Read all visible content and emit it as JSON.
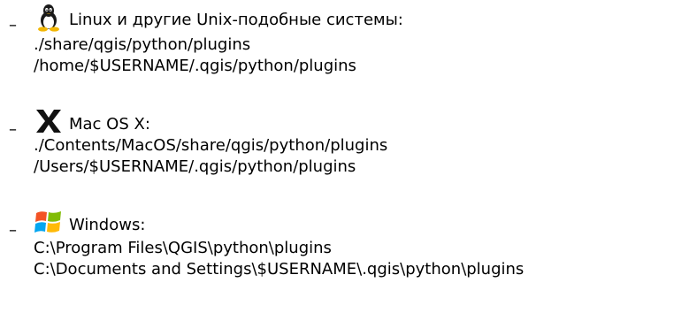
{
  "items": [
    {
      "os": "Linux и другие Unix-подобные системы:",
      "icon": "tux-penguin-icon",
      "paths": [
        "./share/qgis/python/plugins",
        "/home/$USERNAME/.qgis/python/plugins"
      ]
    },
    {
      "os": "Mac OS X:",
      "icon": "mac-os-x-icon",
      "paths": [
        "./Contents/MacOS/share/qgis/python/plugins",
        "/Users/$USERNAME/.qgis/python/plugins"
      ]
    },
    {
      "os": "Windows:",
      "icon": "windows-flag-icon",
      "paths": [
        "C:\\Program Files\\QGIS\\python\\plugins",
        "C:\\Documents and Settings\\$USERNAME\\.qgis\\python\\plugins"
      ]
    }
  ],
  "dash": "–",
  "colors": {
    "text": "#000000",
    "windows_red": "#f35325",
    "windows_green": "#81bc06",
    "windows_blue": "#05a6f0",
    "windows_yellow": "#ffba08"
  }
}
